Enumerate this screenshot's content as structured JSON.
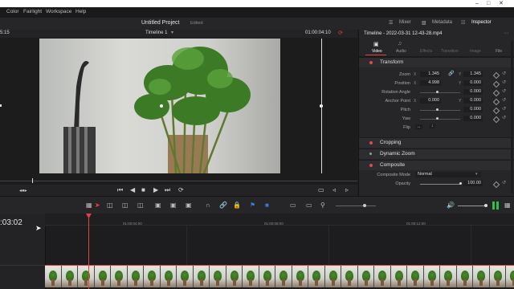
{
  "menu": {
    "items": [
      "Color",
      "Fairlight",
      "Workspace",
      "Help"
    ]
  },
  "header": {
    "timecode_left": "5:15",
    "project_title": "Untitled Project",
    "edit_status": "Edited",
    "tabs": [
      "Mixer",
      "Metadata",
      "Inspector"
    ]
  },
  "viewer": {
    "timeline_name": "Timeline 1",
    "timecode": "01:00:04:10"
  },
  "inspector": {
    "title": "Timeline - 2022-03-31 12-43-28.mp4",
    "tabs": [
      "Video",
      "Audio",
      "Effects",
      "Transition",
      "Image",
      "File"
    ],
    "transform": {
      "label": "Transform",
      "zoom_label": "Zoom",
      "zoom_x": "1.345",
      "zoom_y": "1.345",
      "position_label": "Position",
      "position_x": "4.998",
      "position_y": "0.000",
      "rotation_label": "Rotation Angle",
      "rotation": "0.000",
      "anchor_label": "Anchor Point",
      "anchor_x": "0.000",
      "anchor_y": "0.000",
      "pitch_label": "Pitch",
      "pitch": "0.000",
      "yaw_label": "Yaw",
      "yaw": "0.000",
      "flip_label": "Flip"
    },
    "sections": [
      "Cropping",
      "Dynamic Zoom",
      "Composite"
    ],
    "composite": {
      "mode_label": "Composite Mode",
      "mode_value": "Normal",
      "opacity_label": "Opacity",
      "opacity_value": "100.00"
    },
    "axis_x": "X",
    "axis_y": "Y"
  },
  "timeline": {
    "timecode": ":03:02",
    "ruler": [
      "01:00:04:00",
      "01:00:08:00",
      "01:00:12:00"
    ]
  },
  "colors": {
    "accent_red": "#e8403f",
    "blue": "#3a7ad6"
  }
}
